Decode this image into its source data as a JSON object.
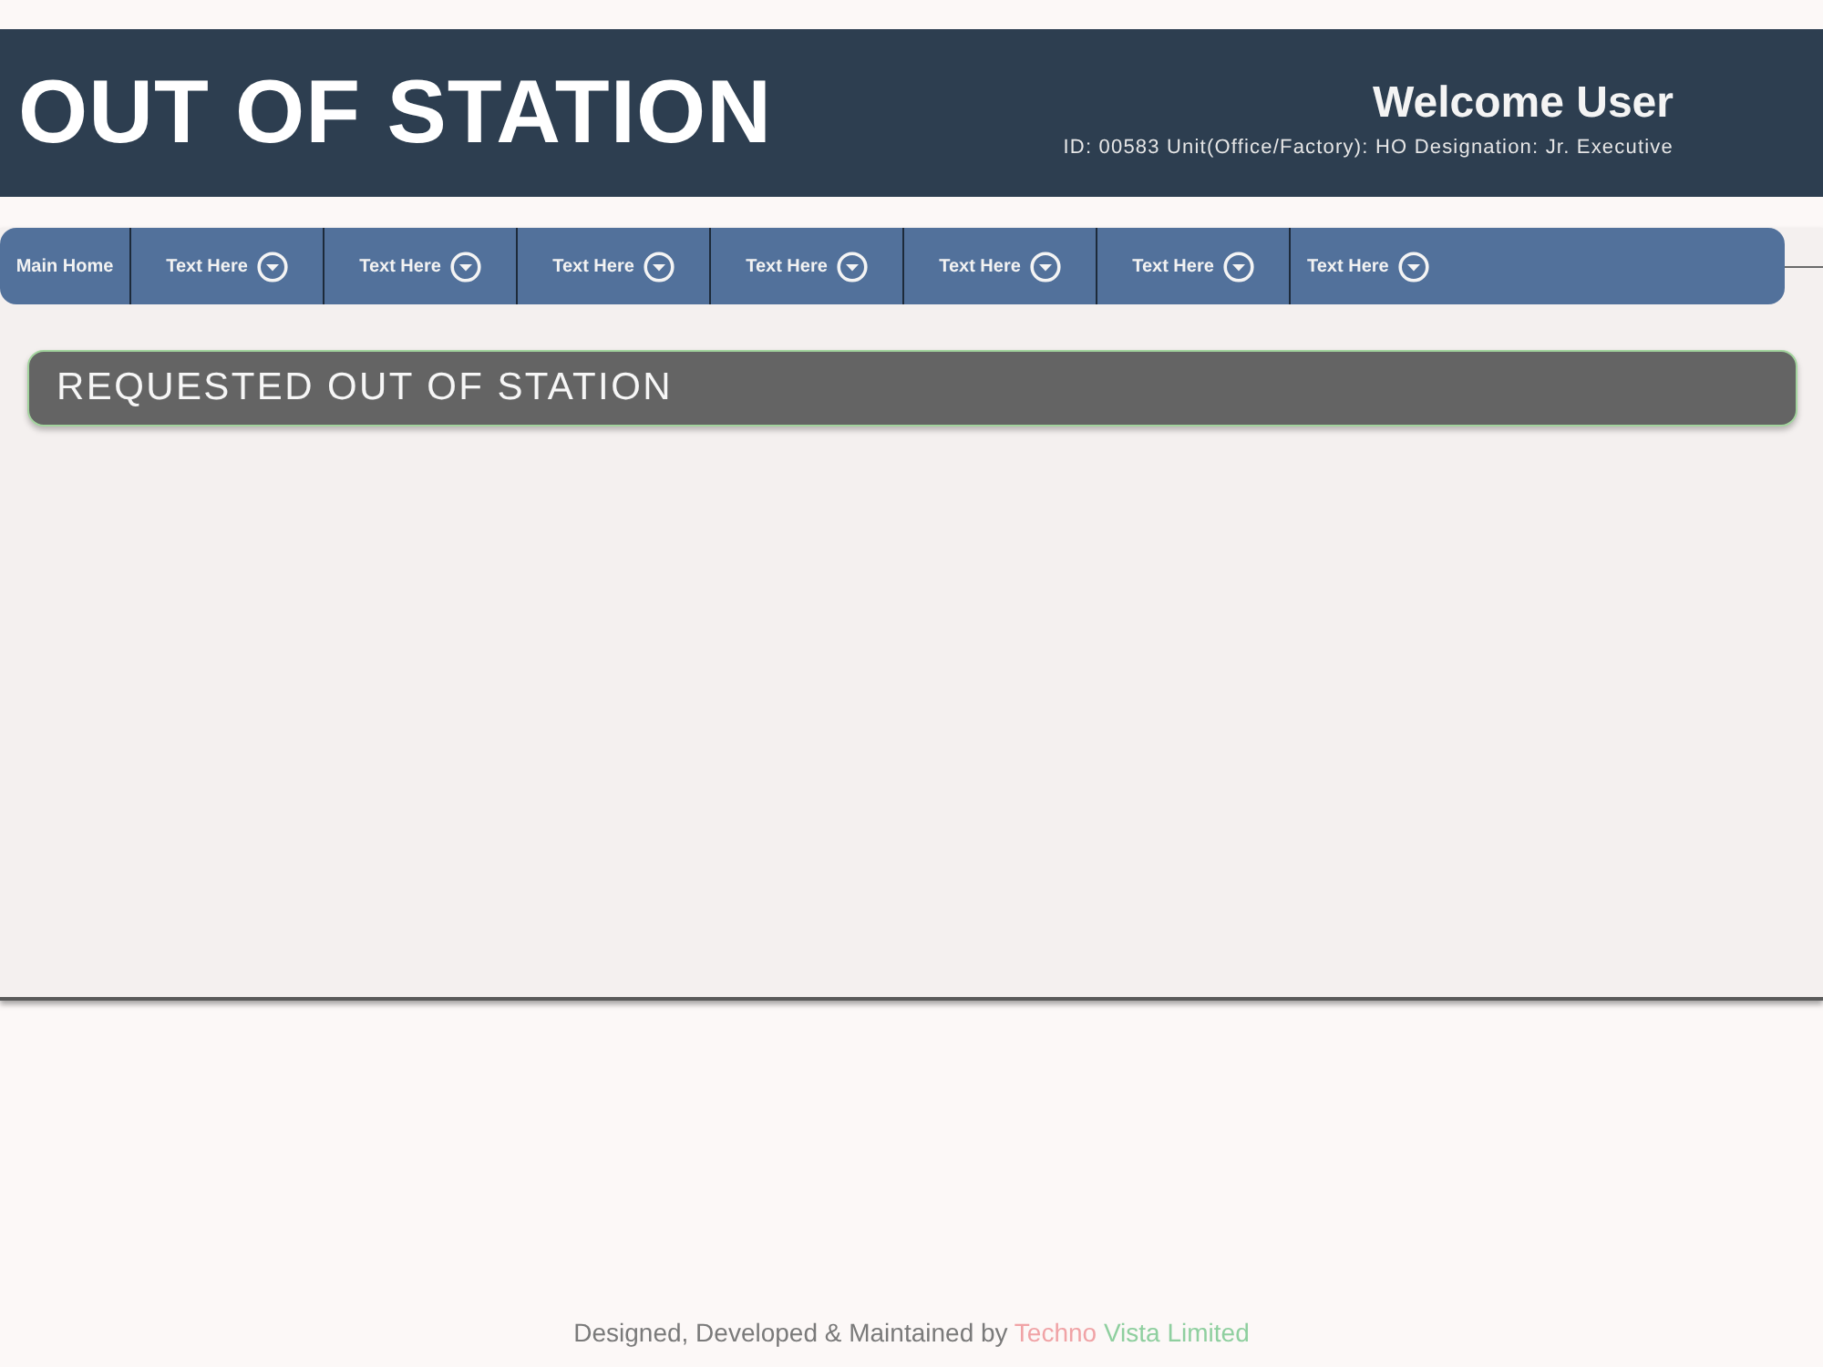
{
  "header": {
    "title": "OUT OF STATION",
    "welcome": "Welcome User",
    "user_info": "ID: 00583 Unit(Office/Factory): HO Designation: Jr. Executive"
  },
  "nav": {
    "items": [
      {
        "label": "Main Home",
        "kind": "link"
      },
      {
        "label": "Text Here",
        "kind": "dropdown"
      },
      {
        "label": "Text Here",
        "kind": "dropdown"
      },
      {
        "label": "Text Here",
        "kind": "dropdown"
      },
      {
        "label": "Text Here",
        "kind": "dropdown"
      },
      {
        "label": "Text Here",
        "kind": "dropdown"
      },
      {
        "label": "Text Here",
        "kind": "dropdown"
      },
      {
        "label": "Text Here",
        "kind": "dropdown"
      }
    ]
  },
  "section": {
    "title": "REQUESTED OUT OF STATION"
  },
  "footer": {
    "text": "Designed, Developed & Maintained by",
    "company": [
      {
        "text": "Techno",
        "color": "#f0a3a6"
      },
      {
        "text": "Vista Limited",
        "color": "#8fcf9f"
      }
    ]
  }
}
